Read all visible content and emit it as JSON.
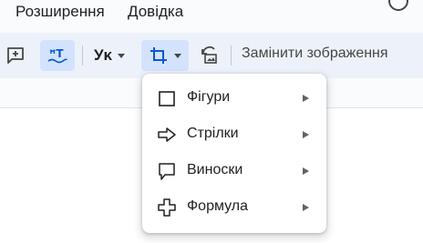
{
  "menubar": {
    "items": [
      "Розширення",
      "Довідка"
    ]
  },
  "toolbar": {
    "text_style_label": "Уᴋ",
    "replace_image_label": "Замінити зображення",
    "icons": [
      "add-comment-icon",
      "insert-text-effect-icon",
      "text-style-icon",
      "crop-icon",
      "reset-image-icon"
    ]
  },
  "shapes_menu": {
    "items": [
      {
        "label": "Фігури",
        "icon": "square-icon"
      },
      {
        "label": "Стрілки",
        "icon": "arrow-icon"
      },
      {
        "label": "Виноски",
        "icon": "callout-icon"
      },
      {
        "label": "Формула",
        "icon": "plus-icon"
      }
    ]
  },
  "colors": {
    "accent": "#d3e3fd",
    "toolbar_bg": "#edf2fa",
    "icon": "#444746",
    "active_icon": "#0b57d0"
  }
}
